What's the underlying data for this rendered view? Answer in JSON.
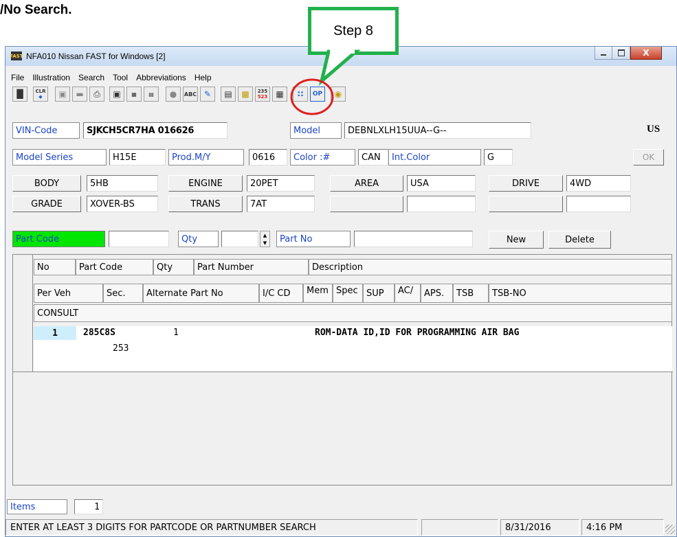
{
  "doc_fragment": "/No Search.",
  "callout": {
    "label": "Step 8",
    "border_color": "#22b14c",
    "circle_color": "#e02020"
  },
  "window": {
    "title": "NFA010 Nissan FAST for Windows [2]",
    "app_icon": "fast-app-icon",
    "controls": [
      "minimize-icon",
      "maximize-icon",
      "close-icon"
    ],
    "close_label": "X"
  },
  "menu": [
    "File",
    "Illustration",
    "Search",
    "Tool",
    "Abbreviations",
    "Help"
  ],
  "toolbar": {
    "clr": "CLR",
    "abc": "ABC",
    "num_top": "235",
    "num_bottom": "523",
    "op": "OP"
  },
  "vehicle": {
    "vin_label": "VIN-Code",
    "vin_value": "SJKCH5CR7HA 016626",
    "model_label": "Model",
    "model_value": "DEBNLXLH15UUA--G--",
    "region": "US",
    "model_series_label": "Model Series",
    "model_series_value": "H15E",
    "prod_label": "Prod.M/Y",
    "prod_value": "0616",
    "color_label": "Color :#",
    "color_value": "CAN",
    "int_color_label": "Int.Color",
    "int_color_value": "G",
    "ok_label": "OK",
    "body_label": "BODY",
    "body_value": "5HB",
    "engine_label": "ENGINE",
    "engine_value": "20PET",
    "area_label": "AREA",
    "area_value": "USA",
    "drive_label": "DRIVE",
    "drive_value": "4WD",
    "grade_label": "GRADE",
    "grade_value": "XOVER-BS",
    "trans_label": "TRANS",
    "trans_value": "7AT"
  },
  "search": {
    "part_code_label": "Part Code",
    "part_code_value": "",
    "qty_label": "Qty",
    "qty_value": "",
    "part_no_label": "Part No",
    "part_no_value": "",
    "new_label": "New",
    "delete_label": "Delete",
    "highlight_color": "#00e600"
  },
  "grid": {
    "header_row1": [
      "No",
      "Part Code",
      "Qty",
      "Part Number",
      "Description"
    ],
    "header_row2": [
      "Per Veh",
      "Sec.",
      "Alternate Part No",
      "I/C CD",
      "Mem",
      "Spec",
      "SUP",
      "AC/",
      "APS.",
      "TSB",
      "TSB-NO"
    ],
    "header_row3": [
      "CONSULT"
    ],
    "rows": [
      {
        "no": "1",
        "part_code": "285C8S",
        "qty": "1",
        "description": "ROM-DATA ID,ID FOR PROGRAMMING AIR BAG",
        "sec": "253"
      }
    ]
  },
  "items": {
    "label": "Items",
    "value": "1"
  },
  "status": {
    "message": "ENTER AT LEAST 3 DIGITS FOR PARTCODE OR PARTNUMBER SEARCH",
    "date": "8/31/2016",
    "time": "4:16 PM"
  }
}
